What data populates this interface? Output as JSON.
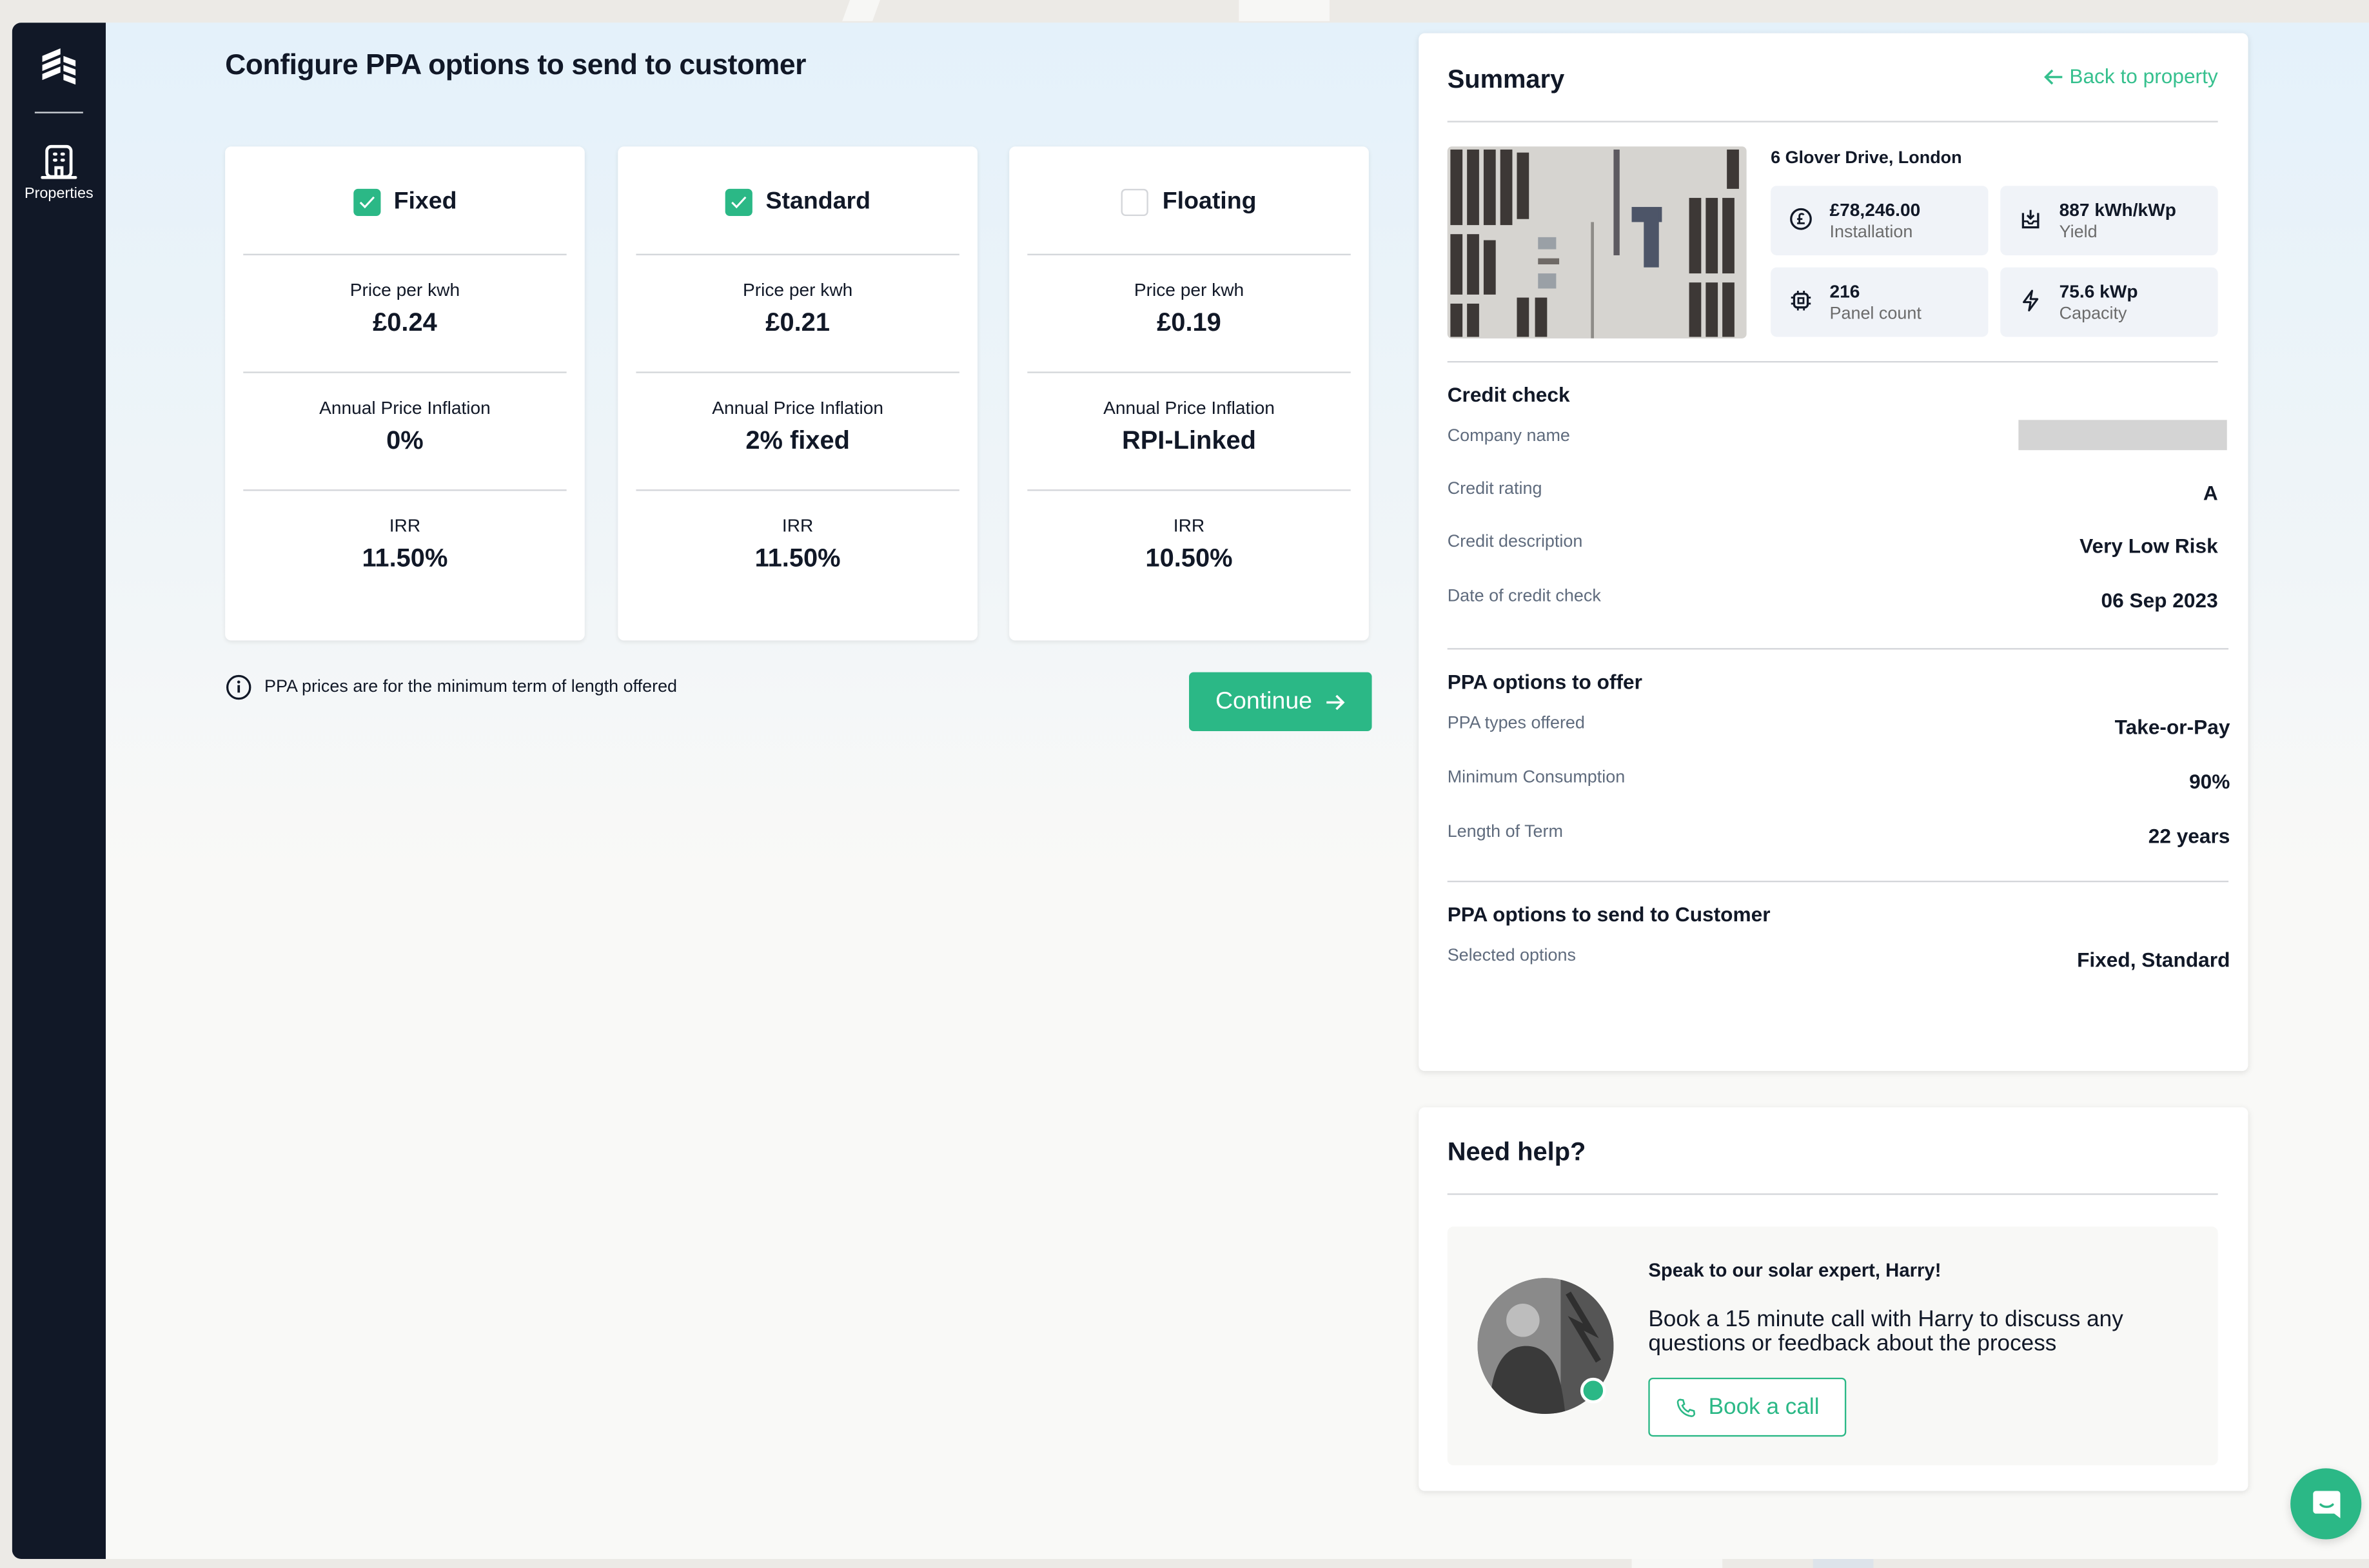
{
  "sidebar": {
    "logo": "company-logo",
    "items": [
      {
        "label": "Properties",
        "icon": "building-icon"
      }
    ]
  },
  "page": {
    "title": "Configure PPA options to send to customer",
    "info_note": "PPA prices are for the minimum term of length offered",
    "continue_label": "Continue"
  },
  "options": [
    {
      "name": "Fixed",
      "checked": true,
      "price_label": "Price per kwh",
      "price": "£0.24",
      "inflation_label": "Annual Price Inflation",
      "inflation": "0%",
      "irr_label": "IRR",
      "irr": "11.50%"
    },
    {
      "name": "Standard",
      "checked": true,
      "price_label": "Price per kwh",
      "price": "£0.21",
      "inflation_label": "Annual Price Inflation",
      "inflation": "2% fixed",
      "irr_label": "IRR",
      "irr": "11.50%"
    },
    {
      "name": "Floating",
      "checked": false,
      "price_label": "Price per kwh",
      "price": "£0.19",
      "inflation_label": "Annual Price Inflation",
      "inflation": "RPI-Linked",
      "irr_label": "IRR",
      "irr": "10.50%"
    }
  ],
  "summary": {
    "title": "Summary",
    "back_link": "Back to property",
    "address": "6 Glover Drive, London",
    "stats": [
      {
        "value": "£78,246.00",
        "label": "Installation",
        "icon": "pound-icon"
      },
      {
        "value": "887 kWh/kWp",
        "label": "Yield",
        "icon": "yield-download-icon"
      },
      {
        "value": "216",
        "label": "Panel count",
        "icon": "chip-icon"
      },
      {
        "value": "75.6 kWp",
        "label": "Capacity",
        "icon": "lightning-icon"
      }
    ],
    "credit_check": {
      "title": "Credit check",
      "rows": [
        {
          "label": "Company name",
          "value": ""
        },
        {
          "label": "Credit rating",
          "value": "A"
        },
        {
          "label": "Credit description",
          "value": "Very Low Risk"
        },
        {
          "label": "Date of credit check",
          "value": "06 Sep 2023"
        }
      ]
    },
    "ppa_offer": {
      "title": "PPA options to offer",
      "rows": [
        {
          "label": "PPA types offered",
          "value": "Take-or-Pay"
        },
        {
          "label": "Minimum Consumption",
          "value": "90%"
        },
        {
          "label": "Length of Term",
          "value": "22 years"
        }
      ]
    },
    "ppa_send": {
      "title": "PPA options to send to Customer",
      "rows": [
        {
          "label": "Selected options",
          "value": "Fixed, Standard"
        }
      ]
    }
  },
  "help": {
    "title": "Need help?",
    "heading": "Speak to our solar expert, Harry!",
    "body": "Book a 15 minute call with Harry to discuss any questions or feedback about the process",
    "button": "Book a call"
  },
  "colors": {
    "accent": "#2bb886",
    "sidebar": "#111827",
    "link": "#36c08e"
  }
}
